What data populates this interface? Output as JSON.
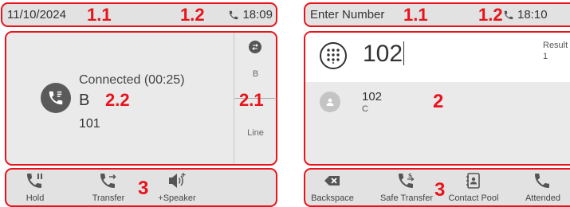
{
  "left": {
    "status": {
      "date": "11/10/2024",
      "time": "18:09"
    },
    "call": {
      "status": "Connected (00:25)",
      "name": "B",
      "number": "101"
    },
    "side_panel": {
      "b_label": "B",
      "line_label": "Line"
    },
    "softkeys": [
      {
        "label": "Hold",
        "icon": "hold-icon"
      },
      {
        "label": "Transfer",
        "icon": "transfer-icon"
      },
      {
        "label": "+Speaker",
        "icon": "speaker-icon"
      }
    ],
    "markers": {
      "m11": "1.1",
      "m12": "1.2",
      "m22": "2.2",
      "m21": "2.1",
      "m3": "3"
    }
  },
  "right": {
    "status": {
      "title": "Enter Number",
      "time": "18:10"
    },
    "input": {
      "value": "102",
      "result_label": "Result",
      "result_count": "1"
    },
    "contact": {
      "number": "102",
      "name": "C"
    },
    "softkeys": [
      {
        "label": "Backspace",
        "icon": "backspace-icon"
      },
      {
        "label": "Safe Transfer",
        "icon": "safe-transfer-icon"
      },
      {
        "label": "Contact Pool",
        "icon": "contact-pool-icon"
      },
      {
        "label": "Attended",
        "icon": "attended-icon"
      }
    ],
    "markers": {
      "m11": "1.1",
      "m12": "1.2",
      "m2": "2",
      "m3": "3"
    }
  },
  "colors": {
    "annotation": "#e8141c",
    "bar": "#e2e2e2",
    "panel": "#eaeaea",
    "icon": "#555555"
  }
}
